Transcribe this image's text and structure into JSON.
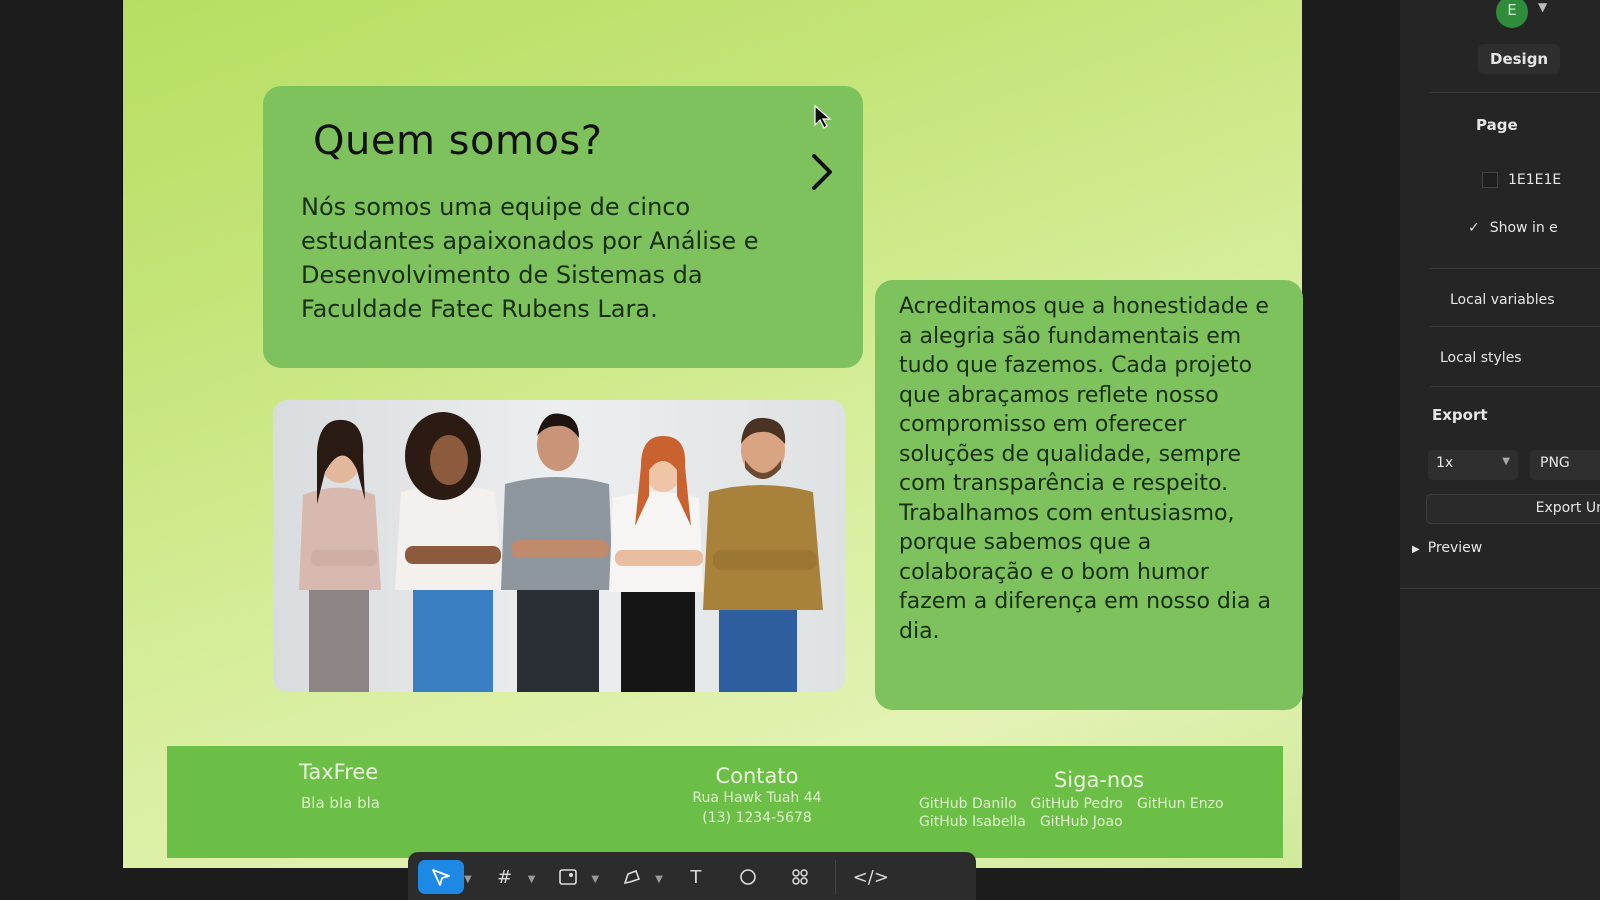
{
  "page": {
    "about": {
      "title": "Quem somos?",
      "text": "Nós somos uma equipe de cinco estudantes apaixonados por Análise e Desenvolvimento de Sistemas da Faculdade Fatec Rubens Lara."
    },
    "values": {
      "text": "Acreditamos que a honestidade e a alegria são fundamentais em tudo que fazemos. Cada projeto que abraçamos reflete nosso compromisso em oferecer soluções de qualidade, sempre com transparência e respeito. Trabalhamos com entusiasmo, porque sabemos que a colaboração e o bom humor fazem a diferença em nosso dia a dia."
    },
    "footer": {
      "brand": "TaxFree",
      "brand_sub": "Bla bla bla",
      "contact_title": "Contato",
      "contact_address": "Rua Hawk Tuah 44",
      "contact_phone": "(13) 1234-5678",
      "social_title": "Siga-nos",
      "social_links": [
        "GitHub Danilo",
        "GitHub Pedro",
        "GitHun Enzo",
        "GitHub Isabella",
        "GitHub Joao"
      ]
    }
  },
  "panel": {
    "avatar_letter": "E",
    "tab_design": "Design",
    "page_title": "Page",
    "page_color": "1E1E1E",
    "show_in_exports": "Show in e",
    "local_variables": "Local variables",
    "local_styles": "Local styles",
    "export_title": "Export",
    "export_scale": "1x",
    "export_format": "PNG",
    "export_button": "Export Un",
    "preview": "Preview"
  },
  "colors": {
    "card_green": "#7dc25c",
    "footer_green": "#6cbf46",
    "panel_bg": "#252525",
    "toolbar_active": "#1e88e5"
  },
  "toolbar": {
    "tools": [
      "move-tool",
      "frame-tool",
      "image-tool",
      "pen-tool",
      "text-tool",
      "comment-tool",
      "actions-tool",
      "dev-mode-tool"
    ]
  }
}
